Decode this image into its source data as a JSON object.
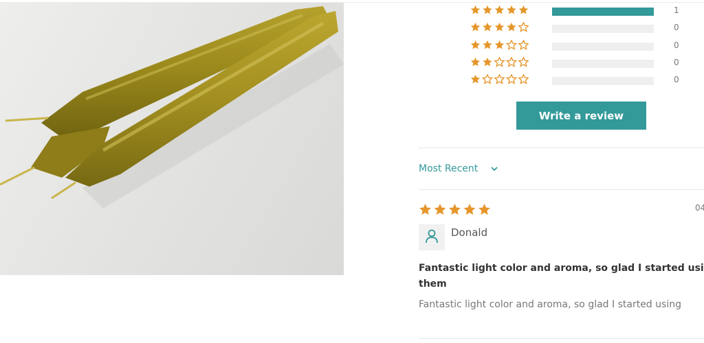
{
  "colors": {
    "accent": "#339999",
    "star": "#e5962b",
    "track": "#efefef"
  },
  "product_image": {
    "alt": "beeswax taper candles"
  },
  "histogram": [
    {
      "stars": 5,
      "fill": 1.0,
      "count": "1"
    },
    {
      "stars": 4,
      "fill": 0.0,
      "count": "0"
    },
    {
      "stars": 3,
      "fill": 0.0,
      "count": "0"
    },
    {
      "stars": 2,
      "fill": 0.0,
      "count": "0"
    },
    {
      "stars": 1,
      "fill": 0.0,
      "count": "0"
    }
  ],
  "write_review_label": "Write a review",
  "sort": {
    "label": "Most Recent",
    "icon": "chevron-down-icon"
  },
  "review": {
    "rating": 5,
    "date": "04",
    "author": "Donald",
    "avatar_icon": "user-icon",
    "title_line1": "Fantastic light color and aroma, so glad I started usi",
    "title_line2": "them",
    "body": "Fantastic light color and aroma, so glad I started using"
  }
}
